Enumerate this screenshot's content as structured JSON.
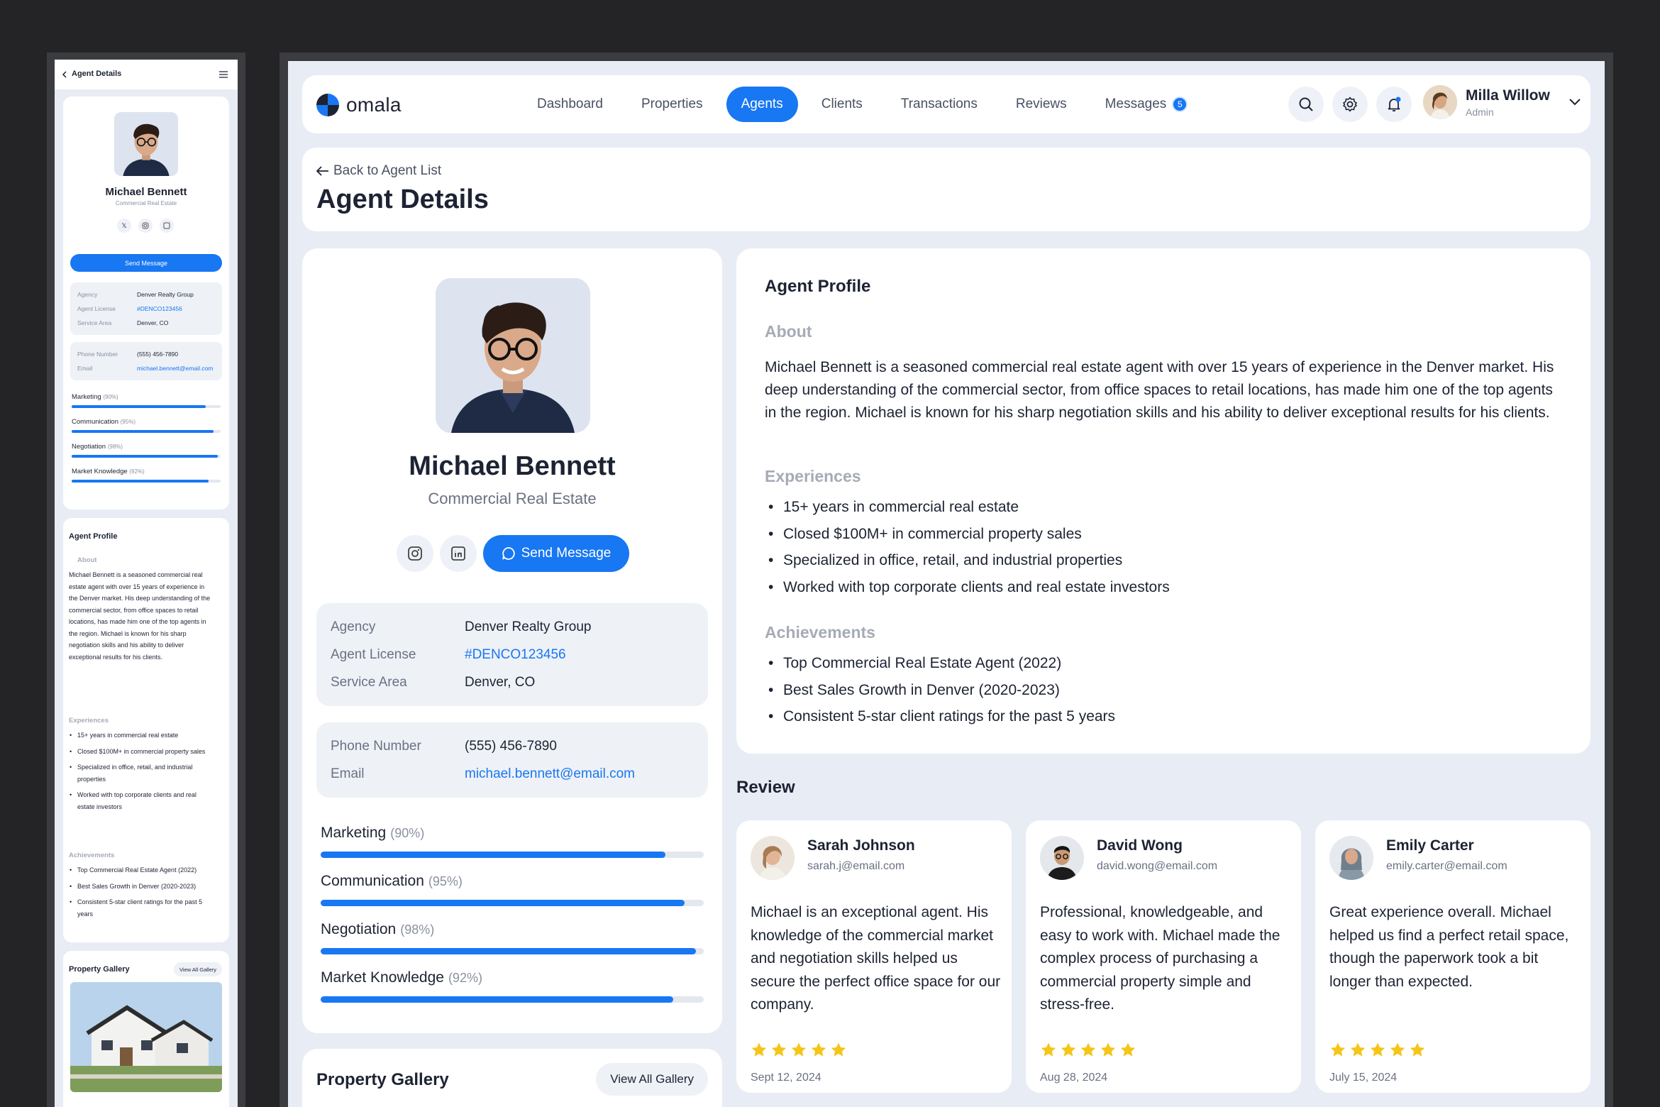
{
  "brand": {
    "name": "omala"
  },
  "nav": {
    "items": [
      {
        "label": "Dashboard"
      },
      {
        "label": "Properties"
      },
      {
        "label": "Agents",
        "active": true
      },
      {
        "label": "Clients"
      },
      {
        "label": "Transactions"
      },
      {
        "label": "Reviews"
      },
      {
        "label": "Messages",
        "badge": "5"
      }
    ]
  },
  "user": {
    "name": "Milla Willow",
    "role": "Admin"
  },
  "header": {
    "back_label": "Back to Agent List",
    "title": "Agent Details"
  },
  "agent": {
    "name": "Michael Bennett",
    "role": "Commercial Real Estate",
    "send_label": "Send Message",
    "details": [
      {
        "label": "Agency",
        "value": "Denver Realty Group"
      },
      {
        "label": "Agent License",
        "value": "#DENCO123456"
      },
      {
        "label": "Service Area",
        "value": "Denver, CO"
      }
    ],
    "contact": [
      {
        "label": "Phone Number",
        "value": "(555) 456-7890"
      },
      {
        "label": "Email",
        "value": "michael.bennett@email.com"
      }
    ],
    "skills": [
      {
        "label": "Marketing",
        "pct_label": "(90%)",
        "value": 0.9
      },
      {
        "label": "Communication",
        "pct_label": "(95%)",
        "value": 0.95
      },
      {
        "label": "Negotiation",
        "pct_label": "(98%)",
        "value": 0.98
      },
      {
        "label": "Market Knowledge",
        "pct_label": "(92%)",
        "value": 0.92
      }
    ]
  },
  "profile": {
    "heading": "Agent Profile",
    "about_heading": "About",
    "about": "Michael Bennett is a seasoned commercial real estate agent with over 15 years of experience in the Denver market. His deep understanding of the commercial sector, from office spaces to retail locations, has made him one of the top agents in the region. Michael is known for his sharp negotiation skills and his ability to deliver exceptional results for his clients.",
    "experiences_heading": "Experiences",
    "experiences": [
      "15+ years in commercial real estate",
      "Closed $100M+ in commercial property sales",
      "Specialized in office, retail, and industrial properties",
      "Worked with top corporate clients and real estate investors"
    ],
    "achievements_heading": "Achievements",
    "achievements": [
      "Top Commercial Real Estate Agent (2022)",
      "Best Sales Growth in Denver (2020-2023)",
      "Consistent 5-star client ratings for the past 5 years"
    ]
  },
  "reviews": {
    "heading": "Review",
    "items": [
      {
        "name": "Sarah Johnson",
        "email": "sarah.j@email.com",
        "text": "Michael is an exceptional agent. His knowledge of the commercial market and negotiation skills helped us secure the perfect office space for our company.",
        "rating": 5,
        "date": "Sept 12, 2024"
      },
      {
        "name": "David Wong",
        "email": "david.wong@email.com",
        "text": "Professional, knowledgeable, and easy to work with. Michael made the complex process of purchasing a commercial property simple and stress-free.",
        "rating": 5,
        "date": "Aug 28, 2024"
      },
      {
        "name": "Emily Carter",
        "email": "emily.carter@email.com",
        "text": "Great experience overall. Michael helped us find a perfect retail space, though the paperwork took a bit longer than expected.",
        "rating": 5,
        "date": "July 15, 2024"
      }
    ]
  },
  "gallery": {
    "heading": "Property Gallery",
    "view_all": "View All Gallery"
  },
  "mobile": {
    "title": "Agent Details",
    "about": "Michael Bennett is a seasoned commercial real estate agent with over 15 years of experience in the Denver market. His deep understanding of the commercial sector, from office spaces to retail locations, has made him one of the top agents in the region. Michael is known for his sharp negotiation skills and his ability to deliver exceptional results for his clients.",
    "experiences": [
      "15+ years in commercial real estate",
      "Closed $100M+ in commercial property sales",
      "Specialized in office, retail, and industrial properties",
      "Worked with top corporate clients and real estate investors"
    ],
    "achievements": [
      "Top Commercial Real Estate Agent (2022)",
      "Best Sales Growth in Denver (2020-2023)",
      "Consistent 5-star client ratings for the past 5 years"
    ]
  },
  "colors": {
    "accent": "#1877f2",
    "star": "#f5c518",
    "background": "#e8ecf5"
  }
}
